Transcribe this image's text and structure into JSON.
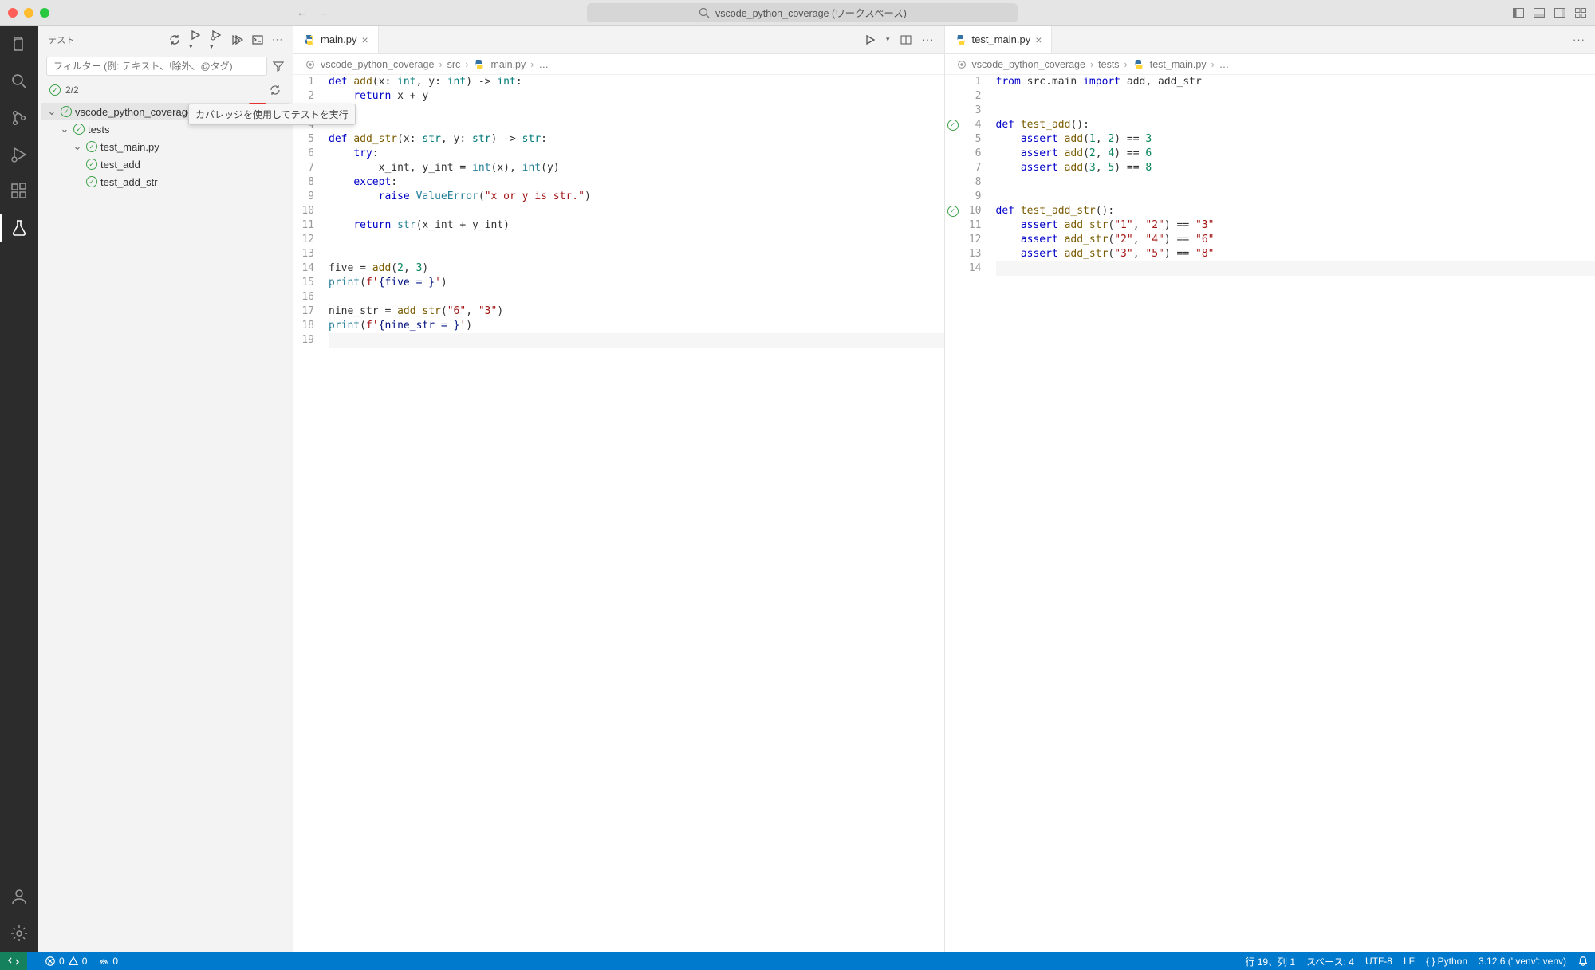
{
  "title": {
    "search": "vscode_python_coverage (ワークスペース)"
  },
  "sidebar": {
    "title": "テスト",
    "filter_placeholder": "フィルター (例: テキスト、!除外、@タグ)",
    "count": "2/2",
    "tree": {
      "root": "vscode_python_coverage",
      "folder": "tests",
      "file": "test_main.py",
      "tests": [
        "test_add",
        "test_add_str"
      ]
    }
  },
  "tooltip": "カバレッジを使用してテストを実行",
  "editor1": {
    "tab": "main.py",
    "crumbs": [
      "vscode_python_coverage",
      "src",
      "main.py",
      "…"
    ],
    "lines": [
      [
        {
          "t": "def ",
          "c": "kw"
        },
        {
          "t": "add",
          "c": "fn"
        },
        {
          "t": "(x: ",
          "c": ""
        },
        {
          "t": "int",
          "c": "ty"
        },
        {
          "t": ", y: ",
          "c": ""
        },
        {
          "t": "int",
          "c": "ty"
        },
        {
          "t": ") -> ",
          "c": ""
        },
        {
          "t": "int",
          "c": "ty"
        },
        {
          "t": ":",
          "c": ""
        }
      ],
      [
        {
          "t": "    ",
          "c": ""
        },
        {
          "t": "return",
          "c": "kw"
        },
        {
          "t": " x + y",
          "c": ""
        }
      ],
      [],
      [],
      [
        {
          "t": "def ",
          "c": "kw"
        },
        {
          "t": "add_str",
          "c": "fn"
        },
        {
          "t": "(x: ",
          "c": ""
        },
        {
          "t": "str",
          "c": "ty"
        },
        {
          "t": ", y: ",
          "c": ""
        },
        {
          "t": "str",
          "c": "ty"
        },
        {
          "t": ") -> ",
          "c": ""
        },
        {
          "t": "str",
          "c": "ty"
        },
        {
          "t": ":",
          "c": ""
        }
      ],
      [
        {
          "t": "    ",
          "c": ""
        },
        {
          "t": "try",
          "c": "kw"
        },
        {
          "t": ":",
          "c": ""
        }
      ],
      [
        {
          "t": "        x_int, y_int = ",
          "c": ""
        },
        {
          "t": "int",
          "c": "bi"
        },
        {
          "t": "(x), ",
          "c": ""
        },
        {
          "t": "int",
          "c": "bi"
        },
        {
          "t": "(y)",
          "c": ""
        }
      ],
      [
        {
          "t": "    ",
          "c": ""
        },
        {
          "t": "except",
          "c": "kw"
        },
        {
          "t": ":",
          "c": ""
        }
      ],
      [
        {
          "t": "        ",
          "c": ""
        },
        {
          "t": "raise",
          "c": "kw"
        },
        {
          "t": " ",
          "c": ""
        },
        {
          "t": "ValueError",
          "c": "bi"
        },
        {
          "t": "(",
          "c": ""
        },
        {
          "t": "\"x or y is str.\"",
          "c": "str"
        },
        {
          "t": ")",
          "c": ""
        }
      ],
      [],
      [
        {
          "t": "    ",
          "c": ""
        },
        {
          "t": "return",
          "c": "kw"
        },
        {
          "t": " ",
          "c": ""
        },
        {
          "t": "str",
          "c": "bi"
        },
        {
          "t": "(x_int + y_int)",
          "c": ""
        }
      ],
      [],
      [],
      [
        {
          "t": "five = ",
          "c": ""
        },
        {
          "t": "add",
          "c": "fn"
        },
        {
          "t": "(",
          "c": ""
        },
        {
          "t": "2",
          "c": "num"
        },
        {
          "t": ", ",
          "c": ""
        },
        {
          "t": "3",
          "c": "num"
        },
        {
          "t": ")",
          "c": ""
        }
      ],
      [
        {
          "t": "print",
          "c": "bi"
        },
        {
          "t": "(",
          "c": ""
        },
        {
          "t": "f'",
          "c": "str"
        },
        {
          "t": "{five = }",
          "c": "id"
        },
        {
          "t": "'",
          "c": "str"
        },
        {
          "t": ")",
          "c": ""
        }
      ],
      [],
      [
        {
          "t": "nine_str = ",
          "c": ""
        },
        {
          "t": "add_str",
          "c": "fn"
        },
        {
          "t": "(",
          "c": ""
        },
        {
          "t": "\"6\"",
          "c": "str"
        },
        {
          "t": ", ",
          "c": ""
        },
        {
          "t": "\"3\"",
          "c": "str"
        },
        {
          "t": ")",
          "c": ""
        }
      ],
      [
        {
          "t": "print",
          "c": "bi"
        },
        {
          "t": "(",
          "c": ""
        },
        {
          "t": "f'",
          "c": "str"
        },
        {
          "t": "{nine_str = }",
          "c": "id"
        },
        {
          "t": "'",
          "c": "str"
        },
        {
          "t": ")",
          "c": ""
        }
      ],
      []
    ]
  },
  "editor2": {
    "tab": "test_main.py",
    "crumbs": [
      "vscode_python_coverage",
      "tests",
      "test_main.py",
      "…"
    ],
    "glyphs": {
      "4": true,
      "10": true
    },
    "lines": [
      [
        {
          "t": "from",
          "c": "kw"
        },
        {
          "t": " src.main ",
          "c": ""
        },
        {
          "t": "import",
          "c": "kw"
        },
        {
          "t": " add, add_str",
          "c": ""
        }
      ],
      [],
      [],
      [
        {
          "t": "def ",
          "c": "kw"
        },
        {
          "t": "test_add",
          "c": "fn"
        },
        {
          "t": "():",
          "c": ""
        }
      ],
      [
        {
          "t": "    ",
          "c": ""
        },
        {
          "t": "assert",
          "c": "kw"
        },
        {
          "t": " ",
          "c": ""
        },
        {
          "t": "add",
          "c": "fn"
        },
        {
          "t": "(",
          "c": ""
        },
        {
          "t": "1",
          "c": "num"
        },
        {
          "t": ", ",
          "c": ""
        },
        {
          "t": "2",
          "c": "num"
        },
        {
          "t": ") == ",
          "c": ""
        },
        {
          "t": "3",
          "c": "num"
        }
      ],
      [
        {
          "t": "    ",
          "c": ""
        },
        {
          "t": "assert",
          "c": "kw"
        },
        {
          "t": " ",
          "c": ""
        },
        {
          "t": "add",
          "c": "fn"
        },
        {
          "t": "(",
          "c": ""
        },
        {
          "t": "2",
          "c": "num"
        },
        {
          "t": ", ",
          "c": ""
        },
        {
          "t": "4",
          "c": "num"
        },
        {
          "t": ") == ",
          "c": ""
        },
        {
          "t": "6",
          "c": "num"
        }
      ],
      [
        {
          "t": "    ",
          "c": ""
        },
        {
          "t": "assert",
          "c": "kw"
        },
        {
          "t": " ",
          "c": ""
        },
        {
          "t": "add",
          "c": "fn"
        },
        {
          "t": "(",
          "c": ""
        },
        {
          "t": "3",
          "c": "num"
        },
        {
          "t": ", ",
          "c": ""
        },
        {
          "t": "5",
          "c": "num"
        },
        {
          "t": ") == ",
          "c": ""
        },
        {
          "t": "8",
          "c": "num"
        }
      ],
      [],
      [],
      [
        {
          "t": "def ",
          "c": "kw"
        },
        {
          "t": "test_add_str",
          "c": "fn"
        },
        {
          "t": "():",
          "c": ""
        }
      ],
      [
        {
          "t": "    ",
          "c": ""
        },
        {
          "t": "assert",
          "c": "kw"
        },
        {
          "t": " ",
          "c": ""
        },
        {
          "t": "add_str",
          "c": "fn"
        },
        {
          "t": "(",
          "c": ""
        },
        {
          "t": "\"1\"",
          "c": "str"
        },
        {
          "t": ", ",
          "c": ""
        },
        {
          "t": "\"2\"",
          "c": "str"
        },
        {
          "t": ") == ",
          "c": ""
        },
        {
          "t": "\"3\"",
          "c": "str"
        }
      ],
      [
        {
          "t": "    ",
          "c": ""
        },
        {
          "t": "assert",
          "c": "kw"
        },
        {
          "t": " ",
          "c": ""
        },
        {
          "t": "add_str",
          "c": "fn"
        },
        {
          "t": "(",
          "c": ""
        },
        {
          "t": "\"2\"",
          "c": "str"
        },
        {
          "t": ", ",
          "c": ""
        },
        {
          "t": "\"4\"",
          "c": "str"
        },
        {
          "t": ") == ",
          "c": ""
        },
        {
          "t": "\"6\"",
          "c": "str"
        }
      ],
      [
        {
          "t": "    ",
          "c": ""
        },
        {
          "t": "assert",
          "c": "kw"
        },
        {
          "t": " ",
          "c": ""
        },
        {
          "t": "add_str",
          "c": "fn"
        },
        {
          "t": "(",
          "c": ""
        },
        {
          "t": "\"3\"",
          "c": "str"
        },
        {
          "t": ", ",
          "c": ""
        },
        {
          "t": "\"5\"",
          "c": "str"
        },
        {
          "t": ") == ",
          "c": ""
        },
        {
          "t": "\"8\"",
          "c": "str"
        }
      ],
      []
    ]
  },
  "status": {
    "errors": "0",
    "warnings": "0",
    "ports": "0",
    "cursor": "行 19、列 1",
    "spaces": "スペース: 4",
    "encoding": "UTF-8",
    "eol": "LF",
    "lang": "{ } Python",
    "py": "3.12.6 ('.venv': venv)"
  }
}
